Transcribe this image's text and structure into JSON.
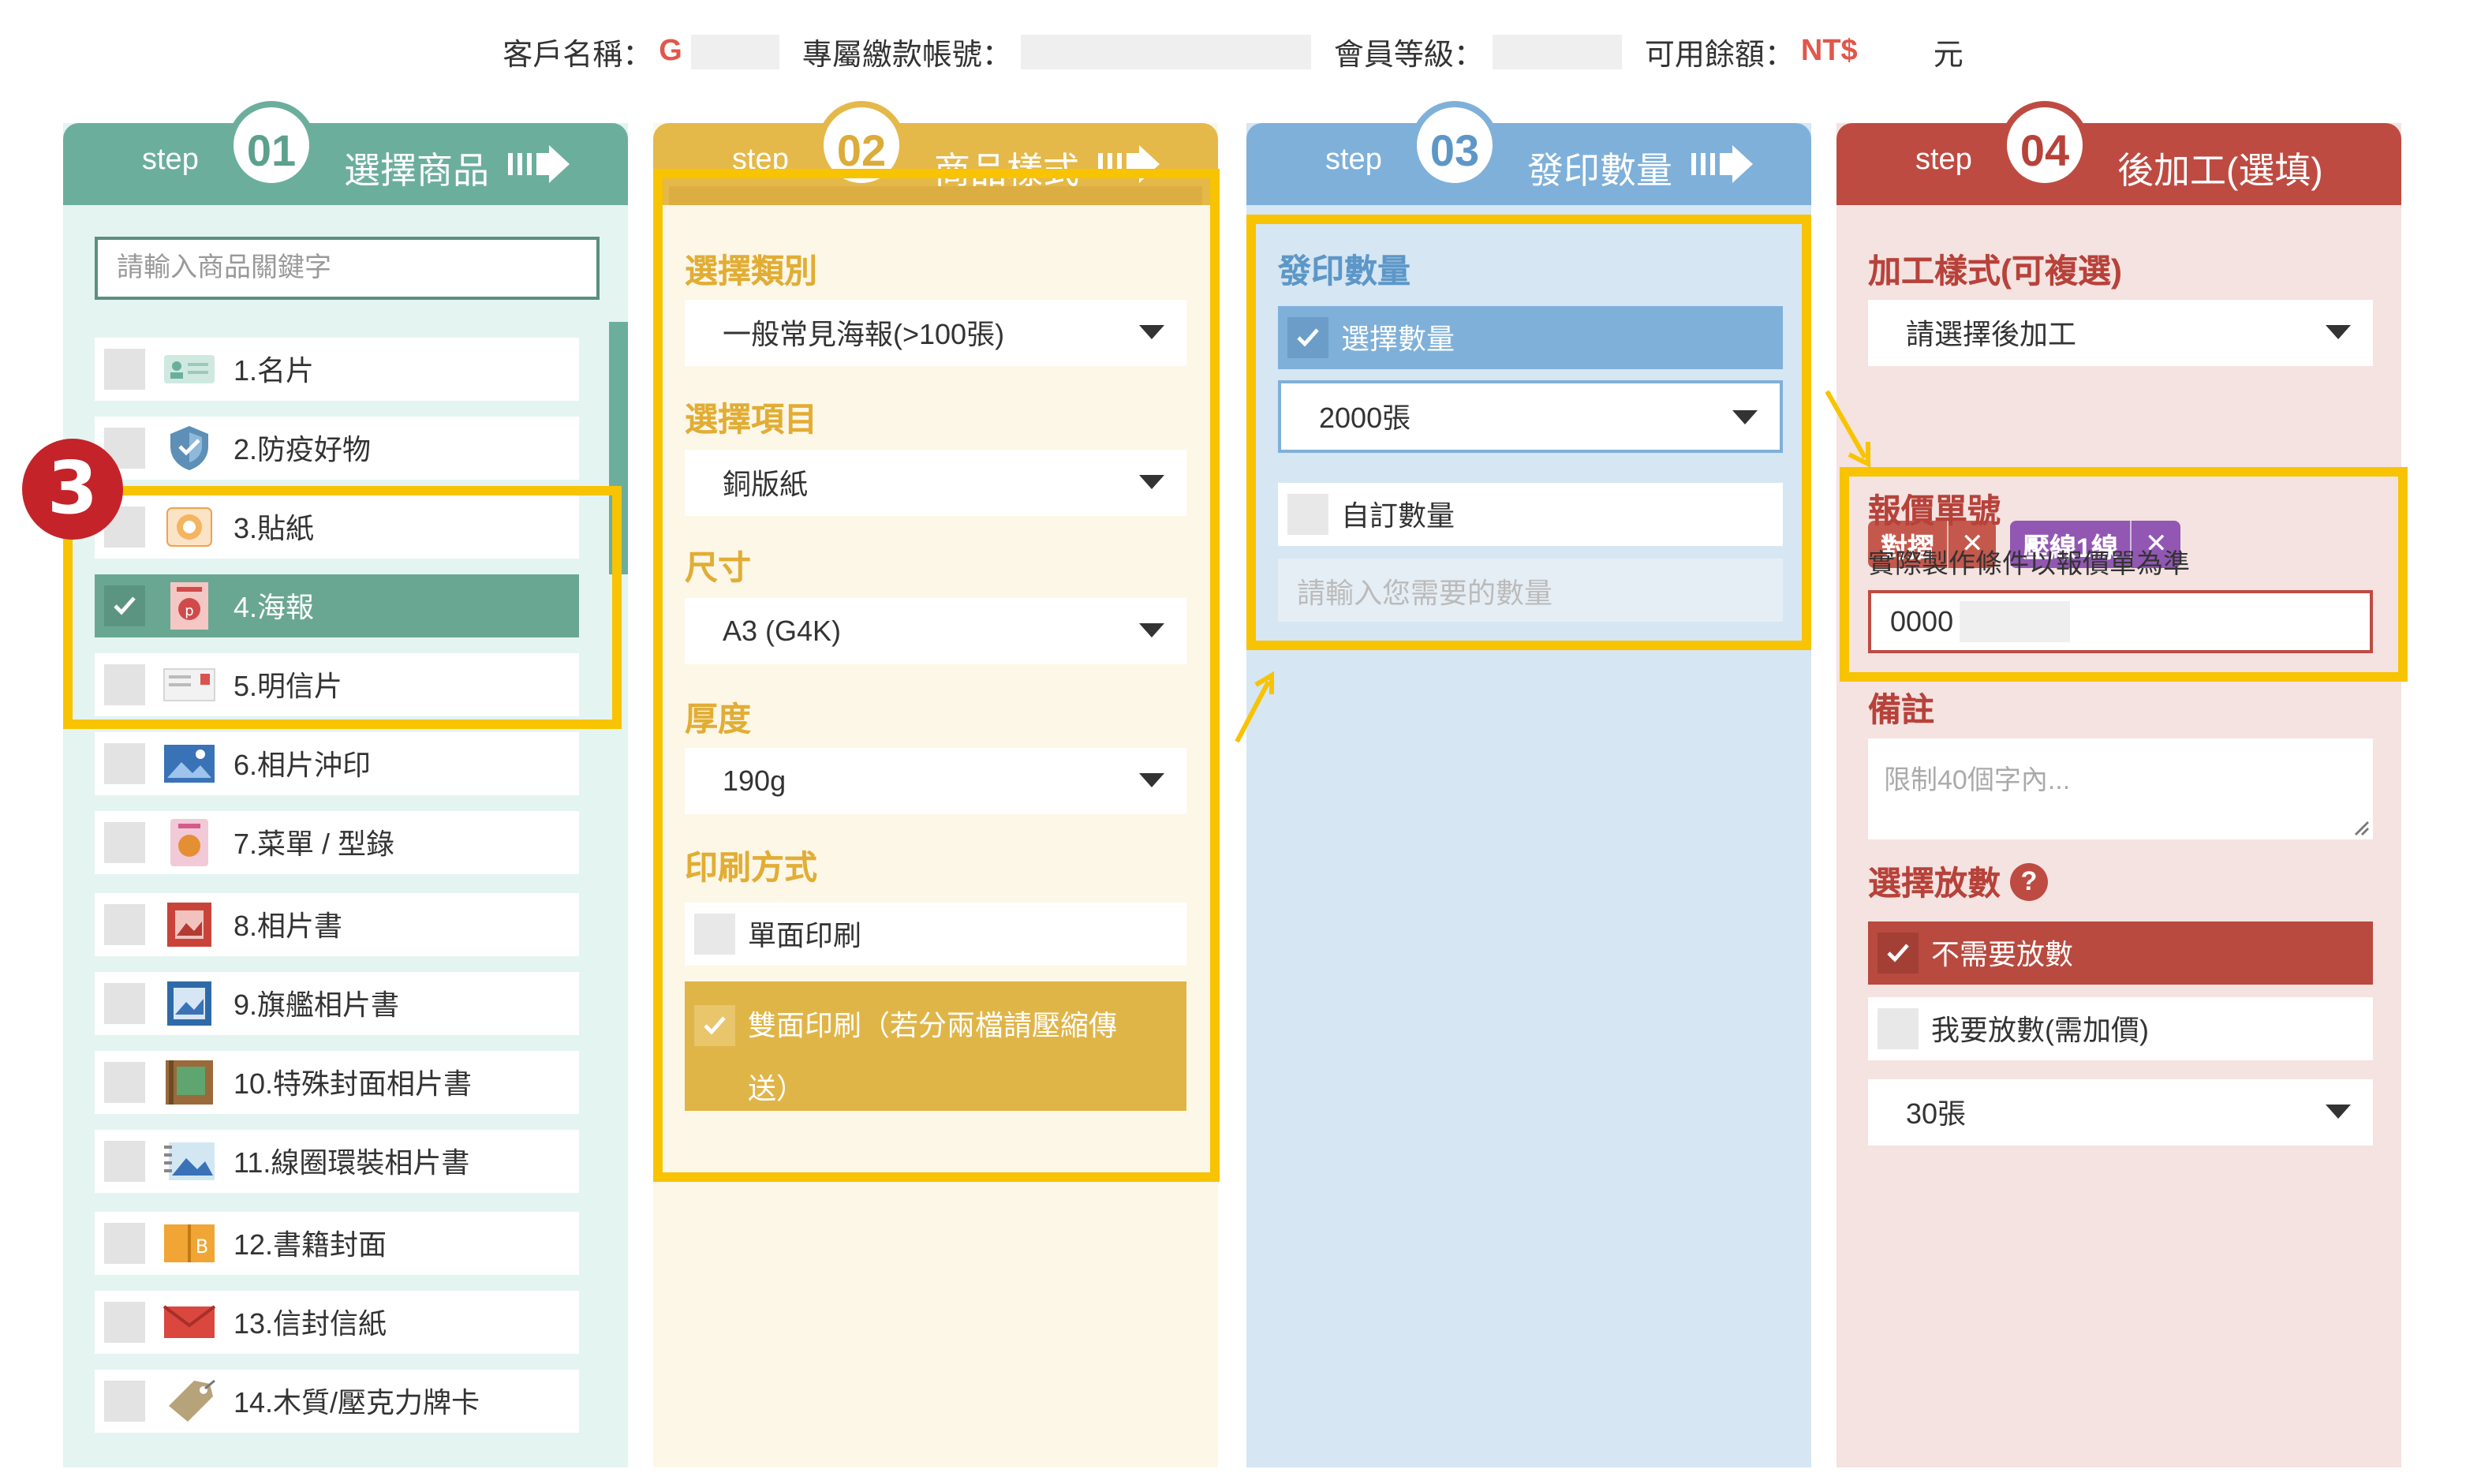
{
  "header": {
    "customer_label": "客戶名稱：",
    "customer_value": "G",
    "account_label": "專屬繳款帳號：",
    "member_label": "會員等級：",
    "balance_label": "可用餘額：",
    "balance_currency": "NT$",
    "balance_unit": "元"
  },
  "steps": {
    "step_word": "step",
    "s1": {
      "num": "01",
      "title": "選擇商品"
    },
    "s2": {
      "num": "02",
      "title": "商品樣式"
    },
    "s3": {
      "num": "03",
      "title": "發印數量"
    },
    "s4": {
      "num": "04",
      "title": "後加工(選填)"
    }
  },
  "products": {
    "search_placeholder": "請輸入商品關鍵字",
    "items": [
      {
        "label": "1.名片",
        "icon": "business-card-icon",
        "selected": false
      },
      {
        "label": "2.防疫好物",
        "icon": "shield-icon",
        "selected": false
      },
      {
        "label": "3.貼紙",
        "icon": "sticker-icon",
        "selected": false
      },
      {
        "label": "4.海報",
        "icon": "poster-icon",
        "selected": true
      },
      {
        "label": "5.明信片",
        "icon": "postcard-icon",
        "selected": false
      },
      {
        "label": "6.相片沖印",
        "icon": "photo-icon",
        "selected": false
      },
      {
        "label": "7.菜單 / 型錄",
        "icon": "menu-icon",
        "selected": false
      },
      {
        "label": "8.相片書",
        "icon": "photobook-icon",
        "selected": false
      },
      {
        "label": "9.旗艦相片書",
        "icon": "flagship-photobook-icon",
        "selected": false
      },
      {
        "label": "10.特殊封面相片書",
        "icon": "special-cover-book-icon",
        "selected": false
      },
      {
        "label": "11.線圈環裝相片書",
        "icon": "spiral-book-icon",
        "selected": false
      },
      {
        "label": "12.書籍封面",
        "icon": "book-cover-icon",
        "selected": false
      },
      {
        "label": "13.信封信紙",
        "icon": "envelope-icon",
        "selected": false
      },
      {
        "label": "14.木質/壓克力牌卡",
        "icon": "wood-tag-icon",
        "selected": false
      }
    ]
  },
  "style": {
    "category_label": "選擇類別",
    "category_value": "一般常見海報(>100張)",
    "item_label": "選擇項目",
    "item_value": "銅版紙",
    "size_label": "尺寸",
    "size_value": "A3 (G4K)",
    "thickness_label": "厚度",
    "thickness_value": "190g",
    "print_label": "印刷方式",
    "single_side": "單面印刷",
    "double_side": "雙面印刷（若分兩檔請壓縮傳送）"
  },
  "quantity": {
    "section_label": "發印數量",
    "choose_label": "選擇數量",
    "choose_value": "2000張",
    "custom_label": "自訂數量",
    "custom_placeholder": "請輸入您需要的數量"
  },
  "post": {
    "process_label": "加工樣式(可複選)",
    "process_placeholder": "請選擇後加工",
    "tags": [
      {
        "label": "對摺",
        "color": "#c5584c"
      },
      {
        "label": "壓線1線",
        "color": "#9257b3"
      }
    ],
    "quote_label": "報價單號",
    "quote_note": "實際製作條件以報價單為準",
    "quote_value": "0000",
    "remark_label": "備註",
    "remark_placeholder": "限制40個字內...",
    "bleed_label": "選擇放數",
    "no_bleed": "不需要放數",
    "want_bleed": "我要放數(需加價)",
    "bleed_value": "30張"
  },
  "annotation": {
    "marker": "3"
  },
  "colors": {
    "highlight": "#f8c300",
    "price": "#e0574b"
  }
}
